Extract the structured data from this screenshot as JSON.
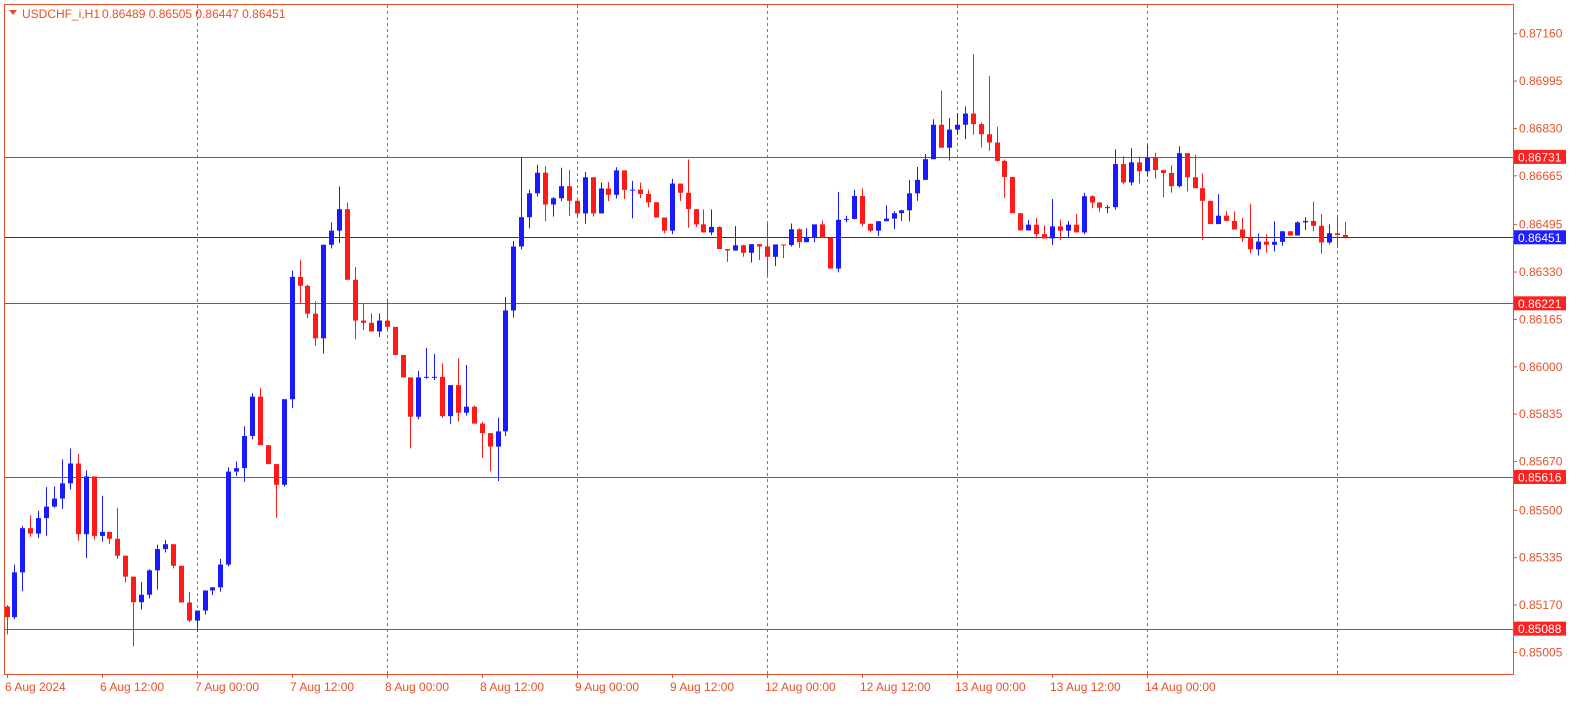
{
  "symbol_label": "USDCHF_i,H1",
  "ohlc_label": "0.86489 0.86505 0.86447 0.86451",
  "colors": {
    "frame": "#e8502a",
    "grid": "#e8502a",
    "bull": "#1a1aff",
    "bear": "#ff1a1a",
    "level": "#ff2020",
    "current": "#2020ff",
    "text": "#e8502a"
  },
  "icons": {
    "collapse": "triangle-down-icon"
  },
  "chart_data": {
    "type": "candlestick",
    "title": "USDCHF_i,H1",
    "ylim": [
      0.8493,
      0.8726
    ],
    "price_ticks": [
      "0.87160",
      "0.86995",
      "0.86830",
      "0.86665",
      "0.86495",
      "0.86330",
      "0.86165",
      "0.86000",
      "0.85835",
      "0.85670",
      "0.85500",
      "0.85335",
      "0.85170",
      "0.85005"
    ],
    "price_tick_values": [
      0.8716,
      0.86995,
      0.8683,
      0.86665,
      0.86495,
      0.8633,
      0.86165,
      0.86,
      0.85835,
      0.8567,
      0.855,
      0.85335,
      0.8517,
      0.85005
    ],
    "time_labels": [
      "6 Aug 2024",
      "6 Aug 12:00",
      "7 Aug 00:00",
      "7 Aug 12:00",
      "8 Aug 00:00",
      "8 Aug 12:00",
      "9 Aug 00:00",
      "9 Aug 12:00",
      "12 Aug 00:00",
      "12 Aug 12:00",
      "13 Aug 00:00",
      "13 Aug 12:00",
      "14 Aug 00:00"
    ],
    "time_label_bar_index": [
      0,
      12,
      24,
      36,
      48,
      60,
      72,
      84,
      96,
      108,
      120,
      132,
      144
    ],
    "grid_bar_index": [
      24,
      48,
      72,
      96,
      120,
      144,
      168
    ],
    "levels": [
      {
        "label": "0.86731",
        "value": 0.86731
      },
      {
        "label": "0.86221",
        "value": 0.86221
      },
      {
        "label": "0.85616",
        "value": 0.85616
      },
      {
        "label": "0.85088",
        "value": 0.85088
      }
    ],
    "current_price": {
      "label": "0.86451",
      "value": 0.86451
    },
    "candles": [
      [
        0.85165,
        0.8517,
        0.85068,
        0.85128
      ],
      [
        0.85128,
        0.85311,
        0.85121,
        0.85284
      ],
      [
        0.85284,
        0.85445,
        0.85218,
        0.85438
      ],
      [
        0.85438,
        0.85483,
        0.85408,
        0.85419
      ],
      [
        0.85419,
        0.85498,
        0.85404,
        0.85473
      ],
      [
        0.85473,
        0.85581,
        0.85411,
        0.85513
      ],
      [
        0.85513,
        0.85583,
        0.85509,
        0.85541
      ],
      [
        0.85541,
        0.85677,
        0.85505,
        0.85594
      ],
      [
        0.85594,
        0.85715,
        0.85573,
        0.85663
      ],
      [
        0.85663,
        0.85697,
        0.85394,
        0.85417
      ],
      [
        0.85417,
        0.85639,
        0.85334,
        0.85618
      ],
      [
        0.85618,
        0.85618,
        0.85398,
        0.85411
      ],
      [
        0.85411,
        0.85551,
        0.85391,
        0.85425
      ],
      [
        0.85425,
        0.85425,
        0.85383,
        0.85401
      ],
      [
        0.85401,
        0.85509,
        0.85331,
        0.85342
      ],
      [
        0.85342,
        0.85342,
        0.85249,
        0.85269
      ],
      [
        0.85269,
        0.85269,
        0.85026,
        0.8518
      ],
      [
        0.8518,
        0.85251,
        0.85155,
        0.85206
      ],
      [
        0.85206,
        0.85295,
        0.85193,
        0.85291
      ],
      [
        0.85291,
        0.8538,
        0.85224,
        0.85365
      ],
      [
        0.85365,
        0.85397,
        0.85353,
        0.85382
      ],
      [
        0.85382,
        0.85382,
        0.85298,
        0.85307
      ],
      [
        0.85307,
        0.85307,
        0.85183,
        0.85179
      ],
      [
        0.85179,
        0.85216,
        0.85111,
        0.85116
      ],
      [
        0.85116,
        0.85151,
        0.85076,
        0.85151
      ],
      [
        0.85151,
        0.85221,
        0.85137,
        0.85221
      ],
      [
        0.85221,
        0.85232,
        0.85205,
        0.85232
      ],
      [
        0.85232,
        0.85331,
        0.85217,
        0.85311
      ],
      [
        0.85311,
        0.8565,
        0.85305,
        0.85635
      ],
      [
        0.85635,
        0.8567,
        0.85619,
        0.85647
      ],
      [
        0.85647,
        0.85793,
        0.85599,
        0.85759
      ],
      [
        0.85759,
        0.85908,
        0.85747,
        0.85896
      ],
      [
        0.85896,
        0.85925,
        0.85741,
        0.85727
      ],
      [
        0.85727,
        0.85727,
        0.85662,
        0.85661
      ],
      [
        0.85661,
        0.85661,
        0.85474,
        0.85589
      ],
      [
        0.85589,
        0.85877,
        0.85583,
        0.85887
      ],
      [
        0.85887,
        0.86335,
        0.85857,
        0.86313
      ],
      [
        0.86313,
        0.86371,
        0.86221,
        0.86282
      ],
      [
        0.86282,
        0.86286,
        0.86169,
        0.86185
      ],
      [
        0.86185,
        0.86228,
        0.86073,
        0.86099
      ],
      [
        0.86099,
        0.86425,
        0.86046,
        0.86425
      ],
      [
        0.86425,
        0.86503,
        0.86412,
        0.86474
      ],
      [
        0.86474,
        0.86628,
        0.86431,
        0.86549
      ],
      [
        0.86549,
        0.86572,
        0.86423,
        0.86303
      ],
      [
        0.86303,
        0.86347,
        0.86096,
        0.86161
      ],
      [
        0.86161,
        0.8622,
        0.86127,
        0.86153
      ],
      [
        0.86153,
        0.86186,
        0.86128,
        0.86123
      ],
      [
        0.86123,
        0.86186,
        0.86104,
        0.86161
      ],
      [
        0.86161,
        0.86238,
        0.86128,
        0.86139
      ],
      [
        0.86139,
        0.86139,
        0.86042,
        0.86041
      ],
      [
        0.86041,
        0.86041,
        0.85969,
        0.85963
      ],
      [
        0.85963,
        0.85963,
        0.85716,
        0.85826
      ],
      [
        0.85826,
        0.85986,
        0.85817,
        0.85963
      ],
      [
        0.85963,
        0.86066,
        0.85958,
        0.85965
      ],
      [
        0.85965,
        0.86044,
        0.85954,
        0.85965
      ],
      [
        0.85965,
        0.86012,
        0.85822,
        0.85828
      ],
      [
        0.85828,
        0.85921,
        0.85801,
        0.85936
      ],
      [
        0.85936,
        0.86029,
        0.8581,
        0.8584
      ],
      [
        0.8584,
        0.86006,
        0.8583,
        0.85861
      ],
      [
        0.85861,
        0.85865,
        0.85809,
        0.85802
      ],
      [
        0.85802,
        0.85809,
        0.85683,
        0.85769
      ],
      [
        0.85769,
        0.85769,
        0.85636,
        0.85722
      ],
      [
        0.85722,
        0.85823,
        0.85602,
        0.85775
      ],
      [
        0.85775,
        0.86243,
        0.85759,
        0.86196
      ],
      [
        0.86196,
        0.86438,
        0.86171,
        0.86419
      ],
      [
        0.86419,
        0.86731,
        0.86409,
        0.86521
      ],
      [
        0.86521,
        0.86617,
        0.86482,
        0.86604
      ],
      [
        0.86604,
        0.86703,
        0.86592,
        0.86676
      ],
      [
        0.86676,
        0.86699,
        0.86507,
        0.86565
      ],
      [
        0.86565,
        0.86591,
        0.86523,
        0.86587
      ],
      [
        0.86587,
        0.86693,
        0.86577,
        0.86629
      ],
      [
        0.86629,
        0.86686,
        0.86525,
        0.86578
      ],
      [
        0.86578,
        0.86581,
        0.86521,
        0.86534
      ],
      [
        0.86534,
        0.86678,
        0.86498,
        0.8666
      ],
      [
        0.8666,
        0.8666,
        0.86523,
        0.86534
      ],
      [
        0.86534,
        0.86642,
        0.86535,
        0.86621
      ],
      [
        0.86621,
        0.86643,
        0.86577,
        0.86599
      ],
      [
        0.86599,
        0.86695,
        0.86586,
        0.86684
      ],
      [
        0.86684,
        0.86684,
        0.86584,
        0.86616
      ],
      [
        0.86616,
        0.86647,
        0.86517,
        0.86617
      ],
      [
        0.86617,
        0.86642,
        0.86588,
        0.86602
      ],
      [
        0.86602,
        0.86617,
        0.86555,
        0.86573
      ],
      [
        0.86573,
        0.86573,
        0.86525,
        0.8652
      ],
      [
        0.8652,
        0.8652,
        0.86465,
        0.86474
      ],
      [
        0.86474,
        0.86655,
        0.86462,
        0.86638
      ],
      [
        0.86638,
        0.86638,
        0.86578,
        0.86606
      ],
      [
        0.86606,
        0.86722,
        0.86484,
        0.86549
      ],
      [
        0.86549,
        0.86549,
        0.86487,
        0.86496
      ],
      [
        0.86496,
        0.86548,
        0.86475,
        0.86468
      ],
      [
        0.86468,
        0.86548,
        0.86458,
        0.86487
      ],
      [
        0.86487,
        0.86489,
        0.86439,
        0.8641
      ],
      [
        0.8641,
        0.8641,
        0.86365,
        0.86405
      ],
      [
        0.86405,
        0.8649,
        0.86404,
        0.86423
      ],
      [
        0.86423,
        0.86425,
        0.86383,
        0.86397
      ],
      [
        0.86397,
        0.86427,
        0.86363,
        0.86427
      ],
      [
        0.86427,
        0.86427,
        0.86372,
        0.86419
      ],
      [
        0.86419,
        0.86499,
        0.86317,
        0.86383
      ],
      [
        0.86383,
        0.86426,
        0.86351,
        0.86426
      ],
      [
        0.86426,
        0.86426,
        0.86378,
        0.86424
      ],
      [
        0.86424,
        0.86499,
        0.86419,
        0.86479
      ],
      [
        0.86479,
        0.86482,
        0.86414,
        0.86434
      ],
      [
        0.86434,
        0.86483,
        0.86439,
        0.86452
      ],
      [
        0.86452,
        0.86488,
        0.86434,
        0.86496
      ],
      [
        0.86496,
        0.86509,
        0.8646,
        0.86449
      ],
      [
        0.86449,
        0.86449,
        0.86363,
        0.86342
      ],
      [
        0.86342,
        0.86609,
        0.86329,
        0.86512
      ],
      [
        0.86512,
        0.86526,
        0.86503,
        0.86515
      ],
      [
        0.86515,
        0.86617,
        0.86513,
        0.86595
      ],
      [
        0.86595,
        0.86621,
        0.86489,
        0.86498
      ],
      [
        0.86498,
        0.86494,
        0.86469,
        0.86474
      ],
      [
        0.86474,
        0.86505,
        0.86456,
        0.86507
      ],
      [
        0.86507,
        0.86562,
        0.86512,
        0.86516
      ],
      [
        0.86516,
        0.86542,
        0.86479,
        0.86535
      ],
      [
        0.86535,
        0.86546,
        0.86508,
        0.86545
      ],
      [
        0.86545,
        0.86651,
        0.86506,
        0.86604
      ],
      [
        0.86604,
        0.86696,
        0.86578,
        0.86651
      ],
      [
        0.86651,
        0.86741,
        0.86657,
        0.86723
      ],
      [
        0.86723,
        0.86862,
        0.86729,
        0.86843
      ],
      [
        0.86843,
        0.86962,
        0.86773,
        0.86763
      ],
      [
        0.86763,
        0.86866,
        0.86718,
        0.86826
      ],
      [
        0.86826,
        0.86883,
        0.86808,
        0.86843
      ],
      [
        0.86843,
        0.86907,
        0.86793,
        0.86882
      ],
      [
        0.86882,
        0.87088,
        0.86808,
        0.86845
      ],
      [
        0.86845,
        0.86851,
        0.86764,
        0.8681
      ],
      [
        0.8681,
        0.87013,
        0.86752,
        0.86781
      ],
      [
        0.86781,
        0.86836,
        0.86715,
        0.86717
      ],
      [
        0.86717,
        0.86722,
        0.86588,
        0.86661
      ],
      [
        0.86661,
        0.86655,
        0.86555,
        0.86535
      ],
      [
        0.86535,
        0.86535,
        0.86491,
        0.86475
      ],
      [
        0.86475,
        0.86511,
        0.86483,
        0.86495
      ],
      [
        0.86495,
        0.86519,
        0.86447,
        0.86462
      ],
      [
        0.86462,
        0.86493,
        0.86464,
        0.86447
      ],
      [
        0.86447,
        0.86584,
        0.86424,
        0.86489
      ],
      [
        0.86489,
        0.86513,
        0.86442,
        0.86474
      ],
      [
        0.86474,
        0.86508,
        0.86452,
        0.86495
      ],
      [
        0.86495,
        0.86532,
        0.86478,
        0.86468
      ],
      [
        0.86468,
        0.86606,
        0.86461,
        0.86594
      ],
      [
        0.86594,
        0.86597,
        0.86552,
        0.86572
      ],
      [
        0.86572,
        0.86574,
        0.86538,
        0.86554
      ],
      [
        0.86554,
        0.86563,
        0.86535,
        0.86556
      ],
      [
        0.86556,
        0.86757,
        0.86547,
        0.86706
      ],
      [
        0.86706,
        0.86733,
        0.86637,
        0.86642
      ],
      [
        0.86642,
        0.86761,
        0.86632,
        0.86712
      ],
      [
        0.86712,
        0.86732,
        0.86638,
        0.86681
      ],
      [
        0.86681,
        0.86772,
        0.86662,
        0.86728
      ],
      [
        0.86728,
        0.86746,
        0.86655,
        0.86685
      ],
      [
        0.86685,
        0.86685,
        0.86591,
        0.86675
      ],
      [
        0.86675,
        0.86702,
        0.86606,
        0.86629
      ],
      [
        0.86629,
        0.86768,
        0.86624,
        0.86744
      ],
      [
        0.86744,
        0.86744,
        0.86611,
        0.8666
      ],
      [
        0.8666,
        0.86739,
        0.86646,
        0.86622
      ],
      [
        0.86622,
        0.86674,
        0.86442,
        0.86578
      ],
      [
        0.86578,
        0.86578,
        0.86497,
        0.86497
      ],
      [
        0.86497,
        0.86601,
        0.86524,
        0.86526
      ],
      [
        0.86526,
        0.86542,
        0.86507,
        0.86508
      ],
      [
        0.86508,
        0.86541,
        0.86483,
        0.86478
      ],
      [
        0.86478,
        0.86519,
        0.86435,
        0.86448
      ],
      [
        0.86448,
        0.86568,
        0.86395,
        0.86409
      ],
      [
        0.86409,
        0.86464,
        0.86387,
        0.86436
      ],
      [
        0.86436,
        0.86461,
        0.86398,
        0.86425
      ],
      [
        0.86425,
        0.86507,
        0.86402,
        0.86435
      ],
      [
        0.86435,
        0.86464,
        0.86421,
        0.86472
      ],
      [
        0.86472,
        0.86459,
        0.86473,
        0.86457
      ],
      [
        0.86457,
        0.86507,
        0.86466,
        0.86503
      ],
      [
        0.86503,
        0.86521,
        0.86476,
        0.86508
      ],
      [
        0.86508,
        0.86575,
        0.86472,
        0.86491
      ],
      [
        0.86491,
        0.86532,
        0.86394,
        0.86433
      ],
      [
        0.86433,
        0.86496,
        0.86426,
        0.86465
      ],
      [
        0.86465,
        0.86524,
        0.86419,
        0.86459
      ],
      [
        0.86459,
        0.86505,
        0.86447,
        0.86451
      ]
    ],
    "candles_note": "OHLC per hourly bar"
  }
}
